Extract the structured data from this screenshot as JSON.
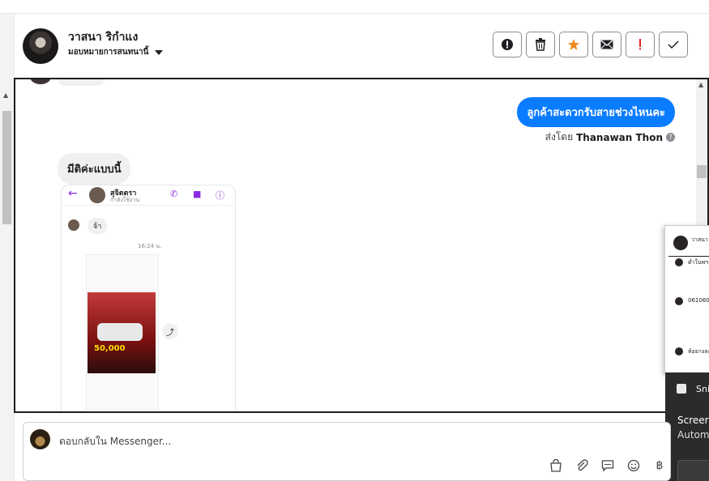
{
  "header": {
    "name": "วาสนา ริกำแง",
    "assign_label": "มอบหมายการสนทนานี้"
  },
  "messages": {
    "outgoing_text": "ลูกค้าสะดวกรับสายช่วงไหนคะ",
    "sent_by_prefix": "ส่งโดย",
    "sent_by_name": "Thanawan Thon",
    "incoming_text": "มีติค่ะแบบนี้"
  },
  "shared_screenshot": {
    "contact_name": "สุจิตตรา",
    "contact_status": "กำลังใช้งาน",
    "message": "จ้า",
    "time": "16:24 น.",
    "promo_price": "50,000"
  },
  "popup": {
    "name": "วาสนา ริ",
    "rows": [
      "ต่ำในพฯ",
      "061060",
      "ห้อยางละ"
    ]
  },
  "toast": {
    "app": "Sni",
    "line1": "Screer",
    "line2": "Autom"
  },
  "composer": {
    "placeholder": "ตอบกลับใน Messenger..."
  },
  "colors": {
    "accent_blue": "#0a7cff",
    "star_orange": "#f08a24",
    "alert_red": "#e02020"
  }
}
